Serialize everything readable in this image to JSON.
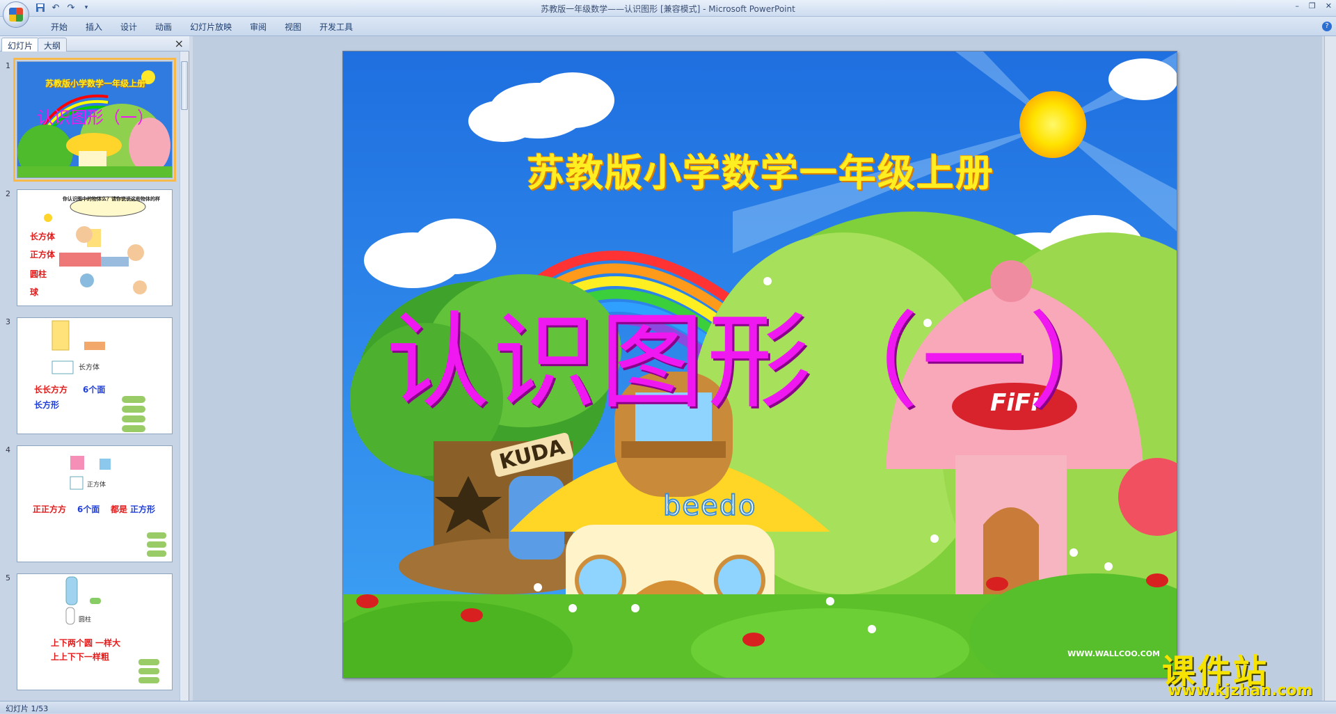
{
  "window": {
    "title": "苏教版一年级数学——认识图形 [兼容模式] - Microsoft PowerPoint",
    "controls": [
      "–",
      "❐",
      "✕"
    ]
  },
  "quick_access": {
    "save_icon": "save-icon",
    "undo_icon": "undo-icon",
    "redo_icon": "redo-icon"
  },
  "ribbon": {
    "tabs": [
      "开始",
      "插入",
      "设计",
      "动画",
      "幻灯片放映",
      "审阅",
      "视图",
      "开发工具"
    ],
    "help": "?"
  },
  "left_panel": {
    "tabs": [
      "幻灯片",
      "大纲"
    ],
    "close": "×",
    "slides": [
      {
        "num": "1",
        "title": "认识图形（一）",
        "subtitle": "苏教版小学数学一年级上册"
      },
      {
        "num": "2",
        "labels": [
          "长方体",
          "正方体",
          "圆柱",
          "球"
        ],
        "bubble": "你认识图中的物体么？请你说说这些物体的样"
      },
      {
        "num": "3",
        "shape_label": "长方体",
        "line1a": "长长方方",
        "line1b": "6个面",
        "line2": "长方形"
      },
      {
        "num": "4",
        "shape_label": "正方体",
        "line1a": "正正方方",
        "line1b": "6个面",
        "line1c": "都是",
        "line1d": "正方形"
      },
      {
        "num": "5",
        "shape_label": "圆柱",
        "line1": "上下两个圆 一样大",
        "line2": "上上下下一样粗"
      }
    ]
  },
  "slide": {
    "subtitle": "苏教版小学数学一年级上册",
    "title": "认识图形（一）",
    "signs": [
      "KUDA",
      "beedo",
      "FiFi"
    ],
    "credit": "WWW.WALLCOO.COM"
  },
  "watermark": {
    "big": "课件站",
    "small": "www.kjzhan.com"
  },
  "status": {
    "slide_counter": "幻灯片 1/53"
  }
}
